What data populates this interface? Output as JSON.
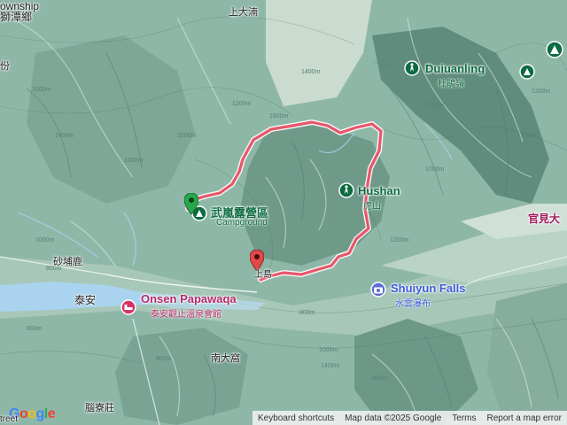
{
  "map": {
    "place_labels": {
      "township": "ownship",
      "township_cn": "獅潭鄉",
      "shangdahu": "上大湳",
      "fen": "份",
      "shibulu": "砂埔鹿",
      "taian": "泰安",
      "nandahu": "南大窩",
      "shulanzhuang": "腦寮莊",
      "guanjian": "官見大",
      "taiwan_partial": "treet"
    },
    "pois": {
      "campground": {
        "name": "武嵐露營區",
        "sub": "Campground"
      },
      "duiuanling": {
        "name": "Duiuanling",
        "sub": "杜鵑嶺"
      },
      "hushan": {
        "name": "Hushan",
        "sub": "虎山"
      },
      "onsen": {
        "name": "Onsen Papawaqa",
        "sub": "泰安觀止溫泉會館"
      },
      "falls": {
        "name": "Shuiyun Falls",
        "sub": "水雲瀑布"
      },
      "trailhead": {
        "name": "上島"
      }
    },
    "contours": [
      "1400m",
      "1200m",
      "1000m",
      "1800m",
      "1600m",
      "1400m",
      "1200m",
      "1000m",
      "800m",
      "800m",
      "600m",
      "1000m",
      "1400m",
      "1600m",
      "1400m",
      "1200m",
      "1000m",
      "1200m",
      "800m",
      "800m"
    ],
    "colors": {
      "route": "#e8566a",
      "route_outline": "#ffffff",
      "terrain": "#8fb7a8",
      "water": "#a9d3ee",
      "poi_green": "#0c6b41",
      "poi_pink": "#d6336c",
      "poi_blue": "#5c6bd6"
    }
  },
  "footer": {
    "shortcuts": "Keyboard shortcuts",
    "data": "Map data ©2025 Google",
    "terms": "Terms",
    "report": "Report a map error"
  },
  "logo": {
    "text_blue1": "G",
    "text_red1": "o",
    "text_yellow": "o",
    "text_blue2": "g",
    "text_green": "l",
    "text_red2": "e"
  }
}
